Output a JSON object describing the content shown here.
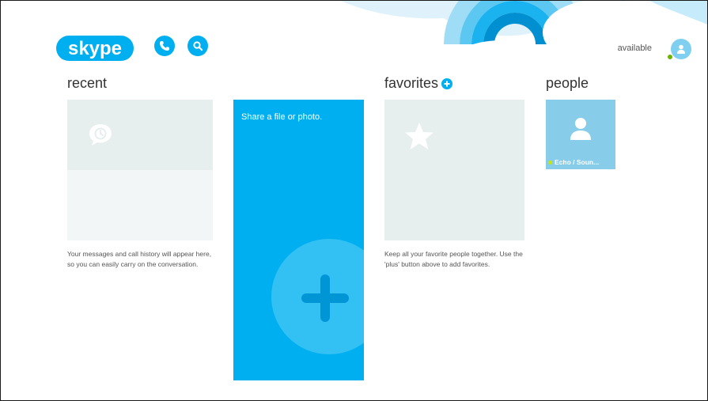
{
  "app": {
    "logo_text": "skype",
    "accent": "#00aff0"
  },
  "header": {
    "call_icon": "phone-icon",
    "search_icon": "search-icon",
    "status_text": "available",
    "avatar_icon": "user-icon",
    "presence_color": "#6bb400"
  },
  "recent": {
    "title": "recent",
    "description": "Your messages and call history will appear here, so you can easily carry on the conversation.",
    "icon": "message-history-icon"
  },
  "share": {
    "label": "Share a file or photo.",
    "icon": "plus-icon"
  },
  "favorites": {
    "title": "favorites",
    "add_icon": "plus-icon",
    "description": "Keep all your favorite people together. Use the 'plus' button above to add favorites.",
    "icon": "star-icon"
  },
  "people": {
    "title": "people",
    "contacts": [
      {
        "name": "Echo / Soun...",
        "presence": "online",
        "icon": "user-icon"
      }
    ]
  }
}
